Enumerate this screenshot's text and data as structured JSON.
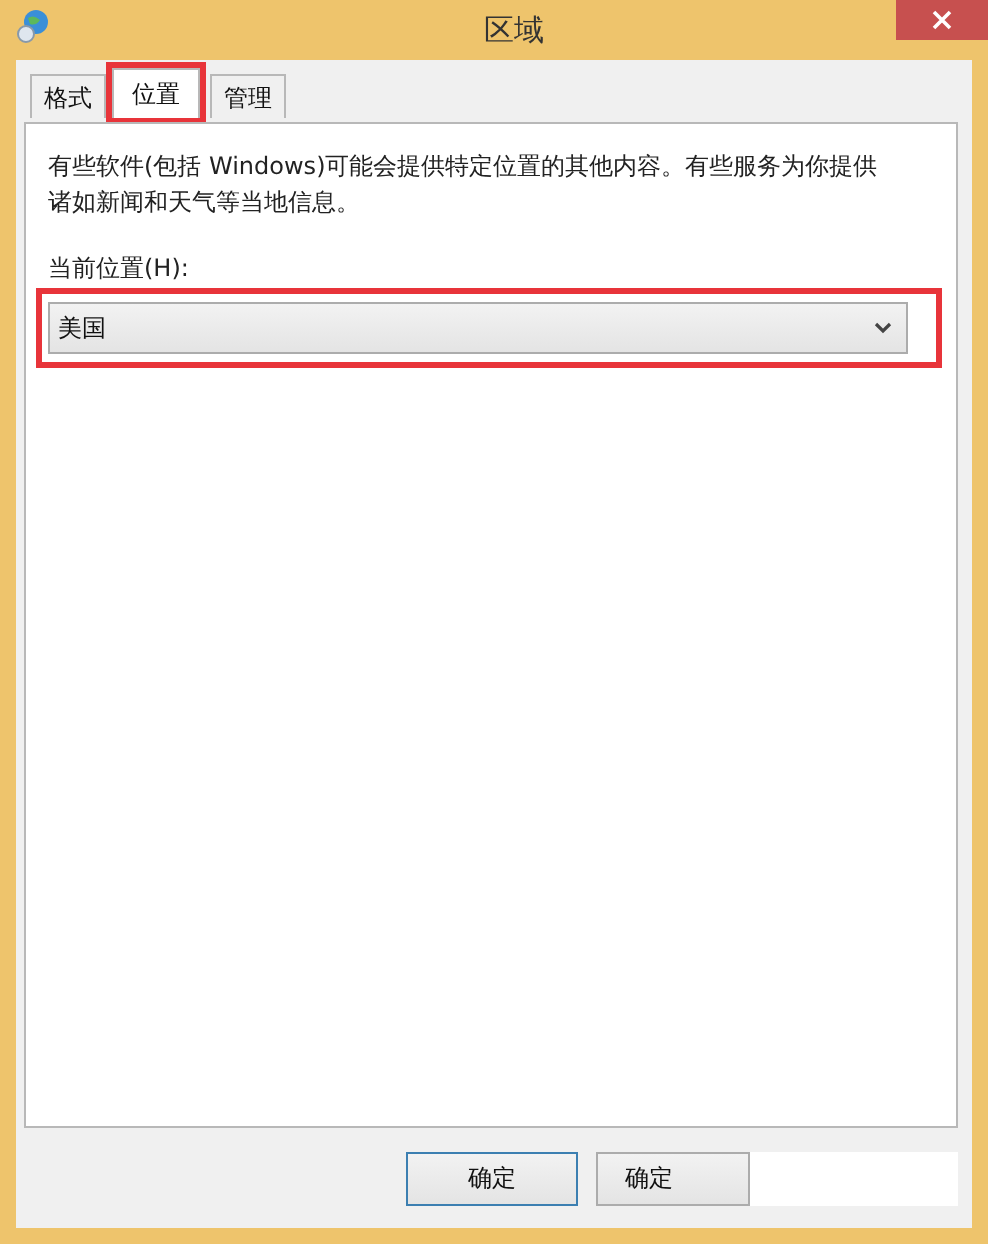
{
  "window": {
    "title": "区域"
  },
  "tabs": [
    {
      "label": "格式",
      "selected": false
    },
    {
      "label": "位置",
      "selected": true,
      "highlighted": true
    },
    {
      "label": "管理",
      "selected": false
    }
  ],
  "description_lines": [
    "有些软件(包括 Windows)可能会提供特定位置的其他内容。有些服务为你提供",
    "诸如新闻和天气等当地信息。"
  ],
  "location": {
    "label": "当前位置(H):",
    "value": "美国",
    "highlighted": true
  },
  "buttons": [
    {
      "label": "确定",
      "focused": true
    },
    {
      "label": "确定",
      "focused": false
    }
  ]
}
